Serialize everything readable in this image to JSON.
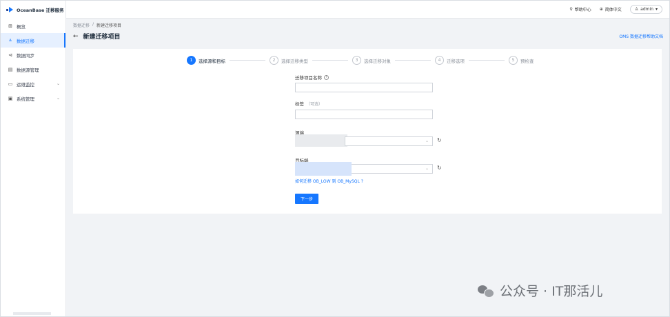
{
  "app": {
    "logo_text": "OceanBase 迁移服务"
  },
  "sidebar": {
    "items": [
      {
        "label": "概览",
        "icon": "grid-icon"
      },
      {
        "label": "数据迁移",
        "icon": "migrate-icon",
        "active": true
      },
      {
        "label": "数据同步",
        "icon": "sync-icon"
      },
      {
        "label": "数据源管理",
        "icon": "datasource-icon"
      },
      {
        "label": "运维监控",
        "icon": "monitor-icon",
        "expandable": true
      },
      {
        "label": "系统管理",
        "icon": "system-icon",
        "expandable": true
      }
    ]
  },
  "topbar": {
    "help": "帮助中心",
    "language": "简体中文",
    "user": "admin"
  },
  "header": {
    "breadcrumb": [
      "数据迁移",
      "/",
      "新建迁移项目"
    ],
    "title": "新建迁移项目",
    "help_doc": "OMS 数据迁移帮助文档"
  },
  "steps": [
    {
      "num": "1",
      "label": "选择源和目标",
      "active": true
    },
    {
      "num": "2",
      "label": "选择迁移类型"
    },
    {
      "num": "3",
      "label": "选择迁移对象"
    },
    {
      "num": "4",
      "label": "迁移选项"
    },
    {
      "num": "5",
      "label": "预检查"
    }
  ],
  "form": {
    "project_name_label": "迁移项目名称",
    "tag_label": "标签",
    "tag_optional": "（可选）",
    "source_label": "源端",
    "target_label": "目标端",
    "help_link": "如何迁移 OB_LOW 到 OB_MySQL ?",
    "next_button": "下一步"
  },
  "watermark": {
    "text": "公众号 · IT那活儿"
  },
  "colors": {
    "accent": "#1677ff",
    "background": "#f1f3f6"
  }
}
